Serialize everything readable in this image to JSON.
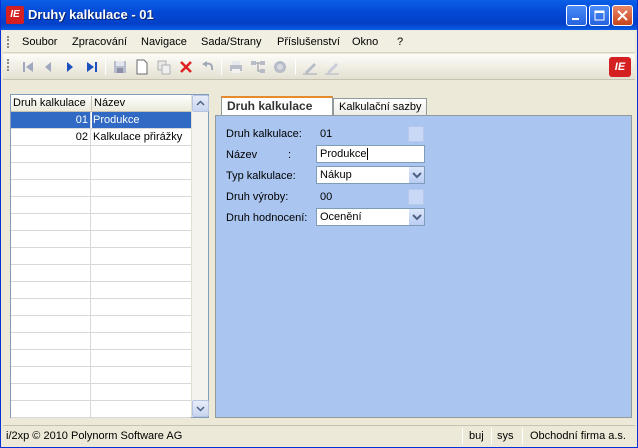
{
  "window": {
    "title": "Druhy kalkulace - 01",
    "app_icon_text": "IE",
    "brand_text": "IE"
  },
  "menu": [
    "Soubor",
    "Zpracování",
    "Navigace",
    "Sada/Strany",
    "Příslušenství",
    "Okno",
    "?"
  ],
  "list": {
    "columns": [
      "Druh kalkulace",
      "Název"
    ],
    "rows": [
      {
        "code": "01",
        "name": "Produkce",
        "selected": true
      },
      {
        "code": "02",
        "name": "Kalkulace přirážky",
        "selected": false
      }
    ]
  },
  "tabs": [
    "Druh kalkulace",
    "Kalkulační sazby"
  ],
  "form": {
    "druh_kalkulace_label": "Druh kalkulace:",
    "druh_kalkulace_value": "01",
    "nazev_label": "Název",
    "nazev_colon": ":",
    "nazev_value": "Produkce",
    "typ_label": "Typ kalkulace:",
    "typ_value": "Nákup",
    "druh_vyroby_label": "Druh výroby:",
    "druh_vyroby_value": "00",
    "druh_hodnoceni_label": "Druh hodnocení:",
    "druh_hodnoceni_value": "Ocenění"
  },
  "status": {
    "copyright": "i/2xp © 2010 Polynorm Software AG",
    "user": "buj",
    "system": "sys",
    "company": "Obchodní firma a.s."
  },
  "colors": {
    "title_bar": "#0449d6",
    "selection": "#316ac5",
    "tab_body": "#a9c5f0",
    "brand_red": "#d42020"
  }
}
